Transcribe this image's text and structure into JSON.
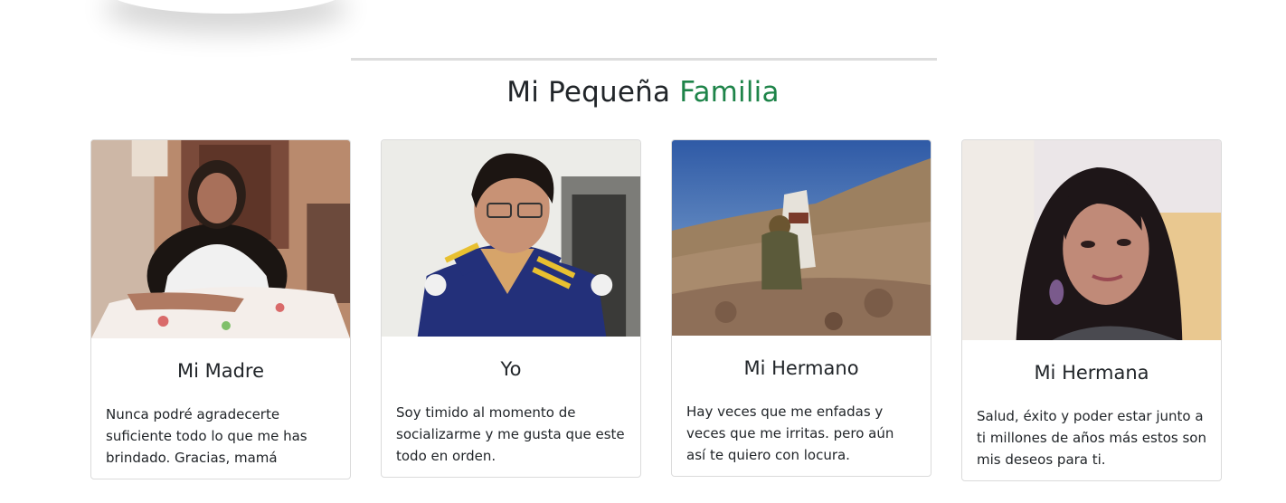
{
  "section": {
    "title_main": "Mi Pequeña ",
    "title_accent": "Familia",
    "accent_color": "#1e8449"
  },
  "cards": [
    {
      "title": "Mi Madre",
      "text": "Nunca podré agradecerte suficiente todo lo que me has brindado. Gracias, mamá",
      "image": "photo-mother"
    },
    {
      "title": "Yo",
      "text": "Soy timido al momento de socializarme y me gusta que este todo en orden.",
      "image": "photo-self"
    },
    {
      "title": "Mi Hermano",
      "text": "Hay veces que me enfadas y veces que me irritas. pero aún así te quiero con locura.",
      "image": "photo-brother"
    },
    {
      "title": "Mi Hermana",
      "text": "Salud, éxito y poder estar junto a ti millones de años más estos son mis deseos para ti.",
      "image": "photo-sister"
    }
  ]
}
